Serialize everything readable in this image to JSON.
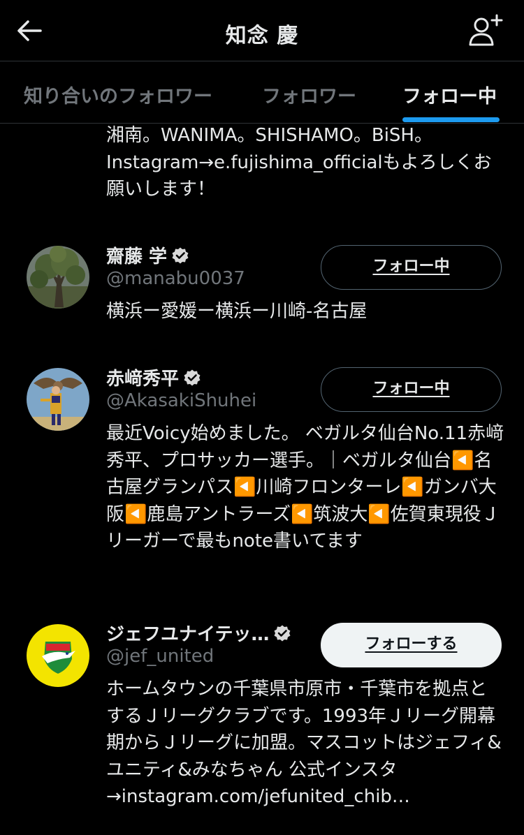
{
  "header": {
    "title": "知念 慶",
    "back_icon": "arrow-left-icon",
    "add_user_icon": "person-plus-icon"
  },
  "tabs": [
    {
      "label": "知り合いのフォロワー"
    },
    {
      "label": "フォロワー"
    },
    {
      "label": "フォロー中",
      "active": true
    }
  ],
  "colors": {
    "background": "#000000",
    "text": "#e7e9ea",
    "muted": "#71767b",
    "accent": "#1d9bf0"
  },
  "feed": {
    "partial_bio": "湘南。WANIMA。SHISHAMO。BiSH。Instagram→e.fujishima_officialもよろしくお願いします！",
    "users": [
      {
        "name": "齋藤 学",
        "handle": "@manabu0037",
        "follow_label": "フォロー中",
        "bio": "横浜ー愛媛ー横浜ー川崎-名古屋",
        "avatar": "tree-photo"
      },
      {
        "name": "赤﨑秀平",
        "handle": "@AkasakiShuhei",
        "follow_label": "フォロー中",
        "bio": "最近Voicy始めました。 ベガルタ仙台No.11赤﨑秀平、プロサッカー選手。｜ベガルタ仙台◀️名古屋グランパス◀️川崎フロンターレ◀️ガンバ大阪◀️鹿島アントラーズ◀️筑波大◀️佐賀東現役Ｊリーガーで最もnote書いてます",
        "avatar": "illustration"
      },
      {
        "name": "ジェフユナイテッ…",
        "handle": "@jef_united",
        "follow_label": "フォローする",
        "bio": "ホームタウンの千葉県市原市・千葉市を拠点とするＪリーグクラブです。1993年Ｊリーグ開幕期からＪリーグに加盟。マスコットはジェフィ&ユニティ&みなちゃん 公式インスタ →instagram.com/jefunited_chib…",
        "avatar": "club-crest"
      }
    ]
  }
}
